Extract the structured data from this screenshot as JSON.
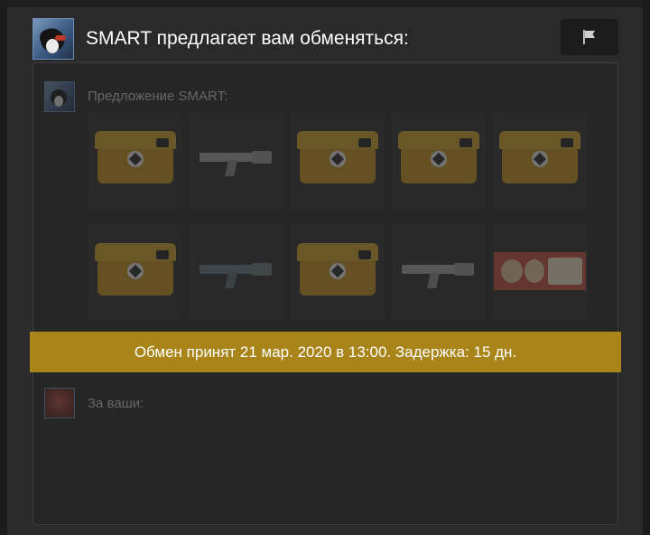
{
  "trade": {
    "title": "SMART предлагает вам обменяться:",
    "partner_name": "SMART",
    "report_icon": "flag-icon",
    "offer_label": "Предложение SMART:",
    "your_label": "За ваши:",
    "status_banner": "Обмен принят 21 мар. 2020 в 13:00. Задержка: 15 дн.",
    "colors": {
      "banner": "#a98419",
      "background": "#2a2a2b",
      "panel": "#262627",
      "avatar_border": "#6b8fb8"
    }
  },
  "offer_items": [
    {
      "kind": "case",
      "icon": "weapon-case-icon"
    },
    {
      "kind": "weapon",
      "icon": "rifle-icon"
    },
    {
      "kind": "case",
      "icon": "weapon-case-icon"
    },
    {
      "kind": "case",
      "icon": "weapon-case-icon"
    },
    {
      "kind": "case",
      "icon": "weapon-case-icon"
    },
    {
      "kind": "case",
      "icon": "weapon-case-icon"
    },
    {
      "kind": "weapon",
      "icon": "pistol-icon"
    },
    {
      "kind": "case",
      "icon": "weapon-case-icon"
    },
    {
      "kind": "weapon",
      "icon": "smg-icon"
    },
    {
      "kind": "sticker",
      "icon": "sticker-icon"
    }
  ]
}
